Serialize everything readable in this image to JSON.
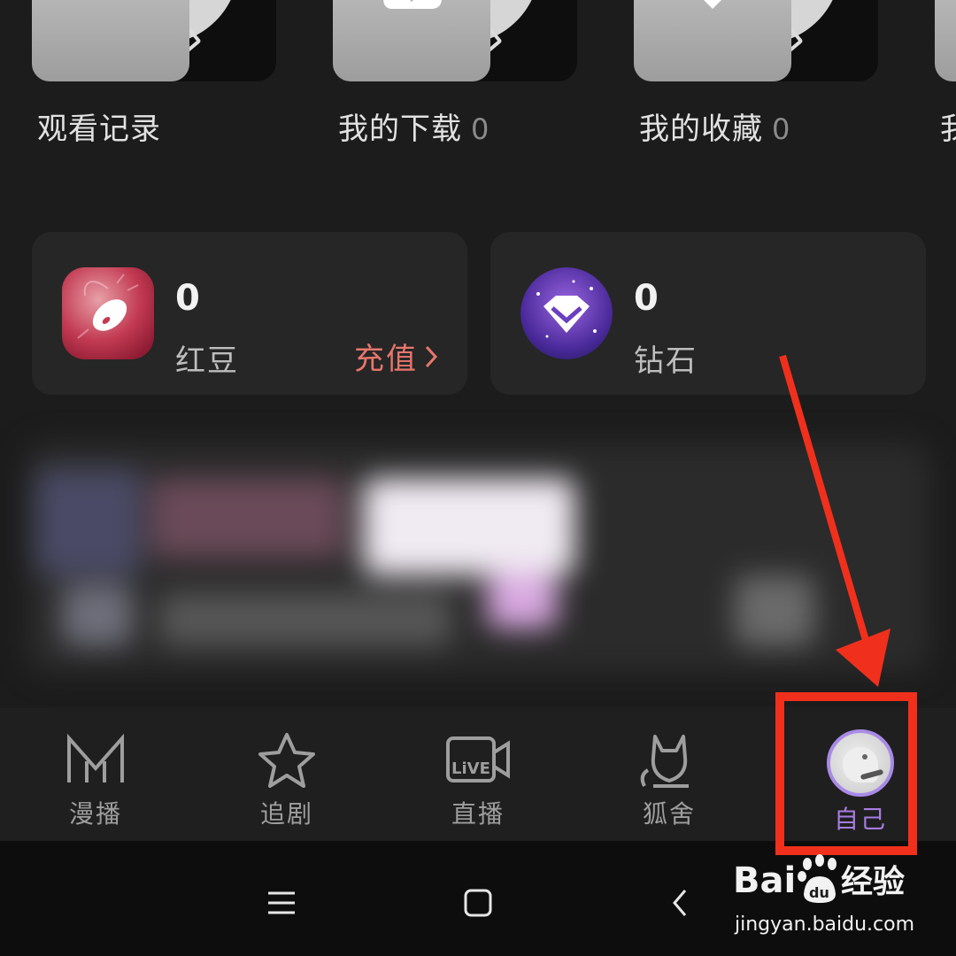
{
  "shelf": {
    "items": [
      {
        "label": "观看记录",
        "count": "",
        "icon": "clock-icon"
      },
      {
        "label": "我的下载",
        "count": "0",
        "icon": "cloud-download-icon"
      },
      {
        "label": "我的收藏",
        "count": "0",
        "icon": "star-check-icon"
      },
      {
        "label": "我",
        "count": "",
        "icon": ""
      }
    ]
  },
  "wallet": {
    "beans": {
      "value": "0",
      "name": "红豆",
      "action": "充值",
      "icon": "red-bean-icon",
      "color": "#e8766c"
    },
    "diamonds": {
      "value": "0",
      "name": "钻石",
      "icon": "diamond-icon"
    }
  },
  "tabbar": {
    "tabs": [
      {
        "label": "漫播",
        "icon": "manbo-m-icon"
      },
      {
        "label": "追剧",
        "icon": "star-icon"
      },
      {
        "label": "直播",
        "icon": "live-camera-icon"
      },
      {
        "label": "狐舍",
        "icon": "fox-icon"
      },
      {
        "label": "自己",
        "icon": "avatar",
        "active": true
      }
    ],
    "active_color": "#a77ce0"
  },
  "navbar": {
    "buttons": [
      "recent-apps-icon",
      "home-icon",
      "back-icon"
    ]
  },
  "annotation": {
    "color": "#f0301c"
  },
  "watermark": {
    "brand": "Baidu",
    "product": "经验",
    "url": "jingyan.baidu.com"
  }
}
